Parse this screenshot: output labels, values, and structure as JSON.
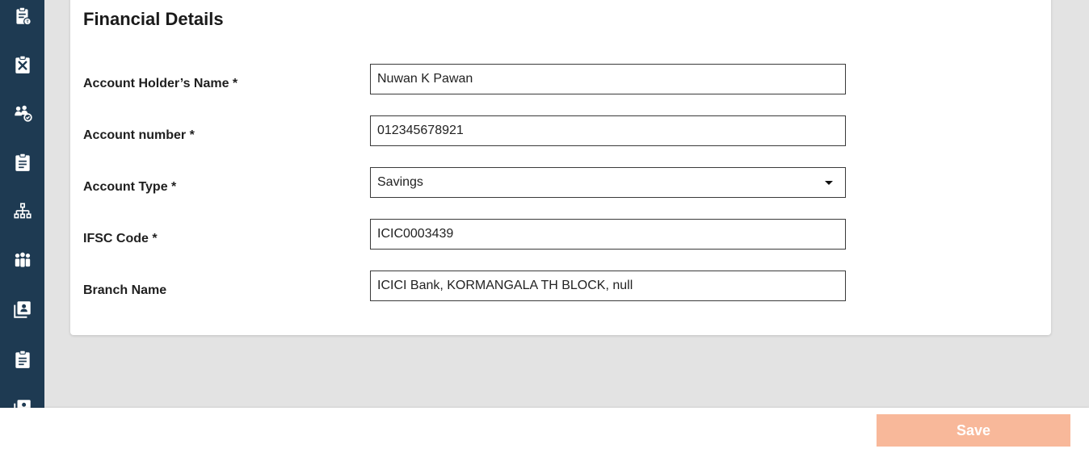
{
  "sidebar": {
    "items": [
      {
        "icon": "clipboard-rupee-icon"
      },
      {
        "icon": "tools-clipboard-icon"
      },
      {
        "icon": "team-approval-icon"
      },
      {
        "icon": "clipboard-list-icon"
      },
      {
        "icon": "org-chart-icon"
      },
      {
        "icon": "group-icon"
      },
      {
        "icon": "contact-book-icon"
      },
      {
        "icon": "assignment-icon"
      },
      {
        "icon": "badge-icon"
      }
    ]
  },
  "section": {
    "title": "Financial Details"
  },
  "form": {
    "fields": [
      {
        "label": "Account Holder’s Name *",
        "value": "Nuwan K Pawan"
      },
      {
        "label": "Account number *",
        "value": "012345678921"
      },
      {
        "label": "Account Type *",
        "value": "Savings"
      },
      {
        "label": "IFSC Code *",
        "value": "ICIC0003439"
      },
      {
        "label": "Branch Name",
        "value": "ICICI Bank, KORMANGALA TH BLOCK, null"
      }
    ]
  },
  "footer": {
    "save_label": "Save"
  },
  "colors": {
    "sidebar_bg": "#1e3a52",
    "save_button_bg": "#f8b89a",
    "page_bg": "#e3e3e3"
  }
}
